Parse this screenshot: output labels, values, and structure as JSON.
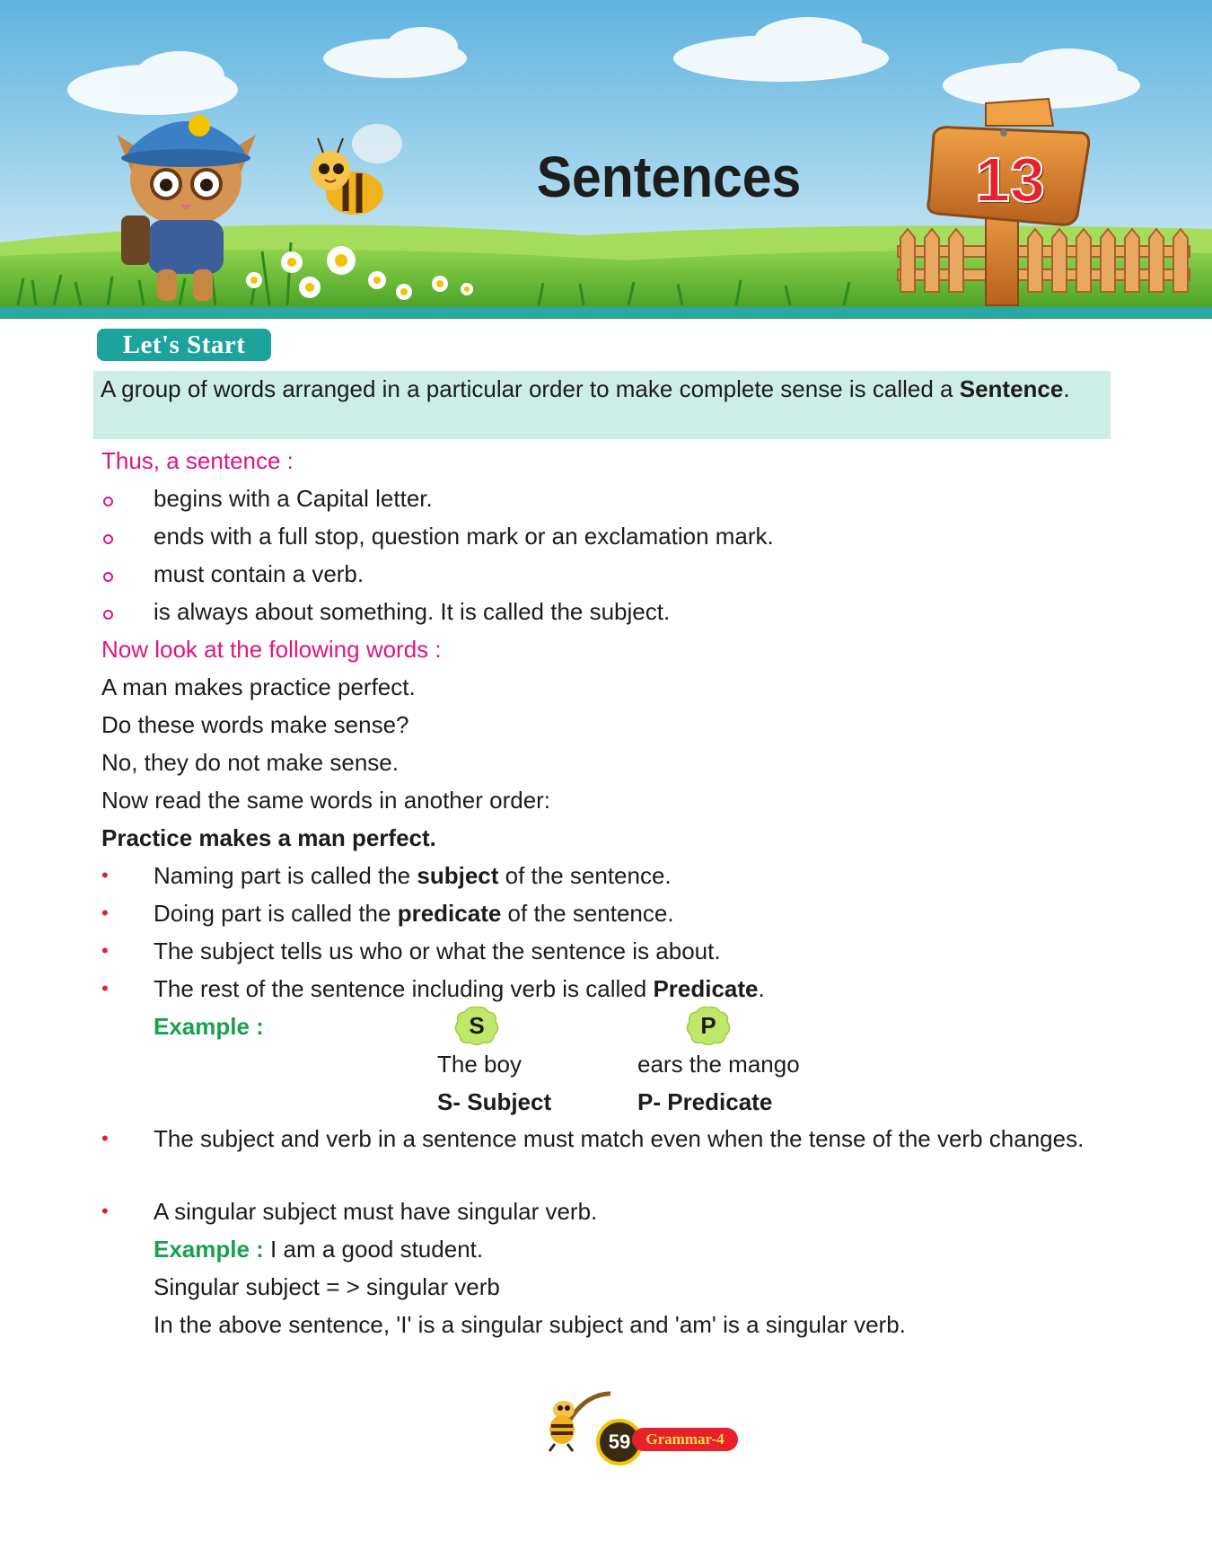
{
  "header": {
    "chapter_title": "Sentences",
    "chapter_number": "13"
  },
  "section_tag": "Let's Start",
  "definition": {
    "text": "A group of words arranged in a particular order to make complete sense is called a ",
    "term": "Sentence",
    "end": "."
  },
  "thus_heading": "Thus, a sentence :",
  "sentence_rules": [
    "begins with a Capital letter.",
    "ends with a full stop, question mark or an exclamation mark.",
    "must contain a verb.",
    "is always about something. It is called the subject."
  ],
  "look_heading": "Now look at the following words :",
  "lines": [
    "A man makes practice perfect.",
    "Do these words make sense?",
    "No, they do not make sense.",
    "Now read the same words in another order:"
  ],
  "bold_sentence": "Practice makes a man perfect.",
  "parts": [
    {
      "before": "Naming part is called the ",
      "bold": "subject",
      "after": " of the sentence."
    },
    {
      "before": "Doing part is called the ",
      "bold": "predicate",
      "after": " of the sentence."
    },
    {
      "before": "The subject tells us who or what the sentence is about.",
      "bold": "",
      "after": ""
    },
    {
      "before": "The rest of the sentence including verb is called ",
      "bold": "Predicate",
      "after": "."
    }
  ],
  "example1": {
    "label": "Example :",
    "s_badge": "S",
    "p_badge": "P",
    "subject_text": "The boy",
    "predicate_text": "ears the mango",
    "s_caption": "S- Subject",
    "p_caption": "P- Predicate"
  },
  "agreement_rule": "The subject and verb in a sentence must match even when the tense of the verb changes.",
  "singular_rule": "A singular subject must have singular verb.",
  "example2": {
    "label": "Example :",
    "text": " I am a good student."
  },
  "singular_line": "Singular subject = > singular verb",
  "explanation_line": "In the above sentence, 'I' is a singular subject and 'am' is a singular verb.",
  "footer": {
    "page_number": "59",
    "book_name": "Grammar-4"
  },
  "colors": {
    "tag_teal": "#1ba39c",
    "definition_bg": "#cdeee6",
    "heading_pink": "#e0157f",
    "example_green": "#1aa050",
    "bullet_red": "#e0202c",
    "number_red": "#e8202c"
  }
}
